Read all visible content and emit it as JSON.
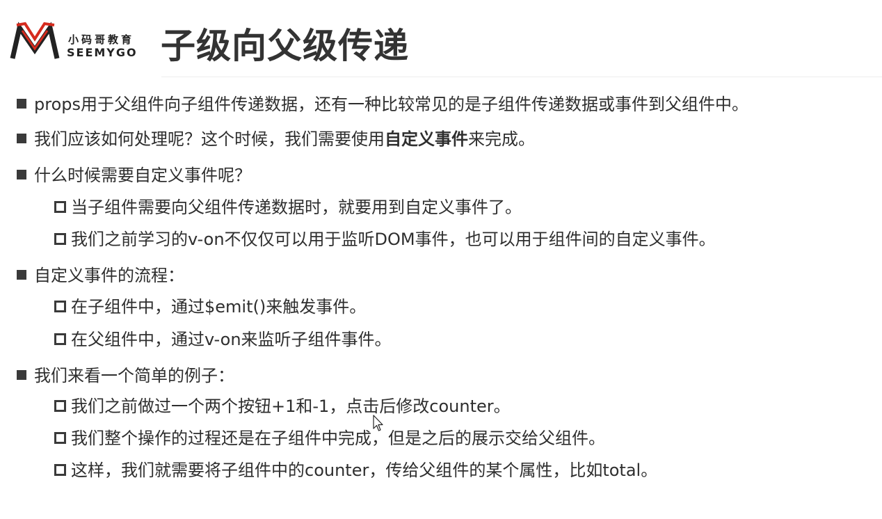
{
  "logo": {
    "cn_text": "小码哥教育",
    "en_text": "SEEMYGO",
    "mark_icon": "seemygo-m-logo-icon",
    "mark_colors": [
      "#d52b1e",
      "#222222"
    ]
  },
  "title": "子级向父级传递",
  "items": [
    {
      "level": 1,
      "text": "props用于父组件向子组件传递数据，还有一种比较常见的是子组件传递数据或事件到父组件中。"
    },
    {
      "level": 1,
      "text_before": "我们应该如何处理呢？这个时候，我们需要使用",
      "text_bold": "自定义事件",
      "text_after": "来完成。"
    },
    {
      "level": 1,
      "text": "什么时候需要自定义事件呢？"
    },
    {
      "level": 2,
      "text": "当子组件需要向父组件传递数据时，就要用到自定义事件了。"
    },
    {
      "level": 2,
      "text": "我们之前学习的v-on不仅仅可以用于监听DOM事件，也可以用于组件间的自定义事件。"
    },
    {
      "level": 1,
      "text": "自定义事件的流程："
    },
    {
      "level": 2,
      "text": "在子组件中，通过$emit()来触发事件。"
    },
    {
      "level": 2,
      "text": "在父组件中，通过v-on来监听子组件事件。"
    },
    {
      "level": 1,
      "text": "我们来看一个简单的例子："
    },
    {
      "level": 2,
      "text": "我们之前做过一个两个按钮+1和-1，点击后修改counter。"
    },
    {
      "level": 2,
      "text": "我们整个操作的过程还是在子组件中完成，但是之后的展示交给父组件。"
    },
    {
      "level": 2,
      "text": "这样，我们就需要将子组件中的counter，传给父组件的某个属性，比如total。"
    }
  ],
  "cursor_icon": "mouse-pointer-icon"
}
